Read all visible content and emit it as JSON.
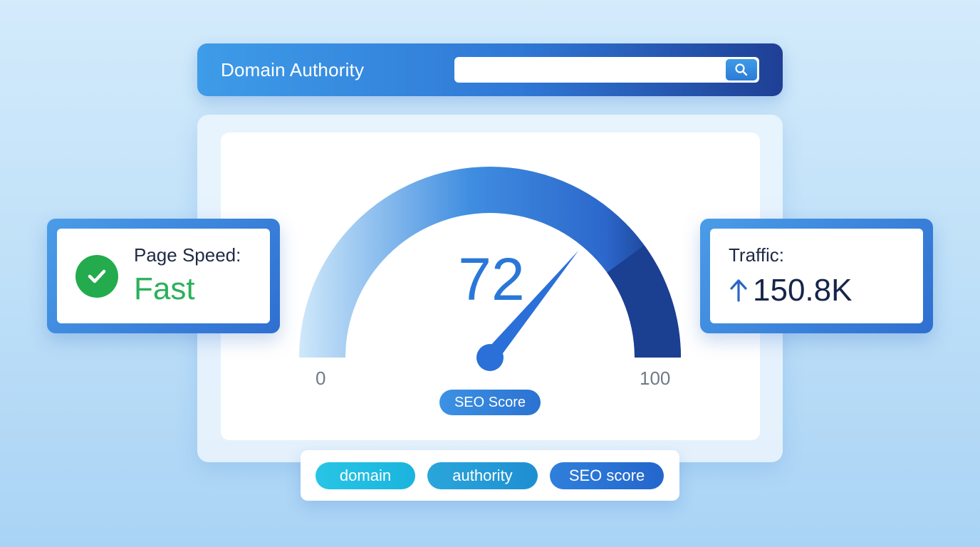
{
  "header": {
    "title": "Domain Authority",
    "search": {
      "value": "",
      "placeholder": ""
    }
  },
  "gauge": {
    "score": "72",
    "min_label": "0",
    "max_label": "100",
    "caption": "SEO Score",
    "value": 72,
    "min": 0,
    "max": 100,
    "colors": {
      "start": "#cfe8fa",
      "mid": "#3f8de0",
      "end": "#14307a",
      "needle": "#2b6fd8"
    }
  },
  "page_speed": {
    "label": "Page Speed:",
    "value": "Fast",
    "icon": "check-circle-icon"
  },
  "traffic": {
    "label": "Traffic:",
    "value": "150.8K",
    "icon": "arrow-up-icon"
  },
  "tags": [
    "domain",
    "authority",
    "SEO score"
  ]
}
